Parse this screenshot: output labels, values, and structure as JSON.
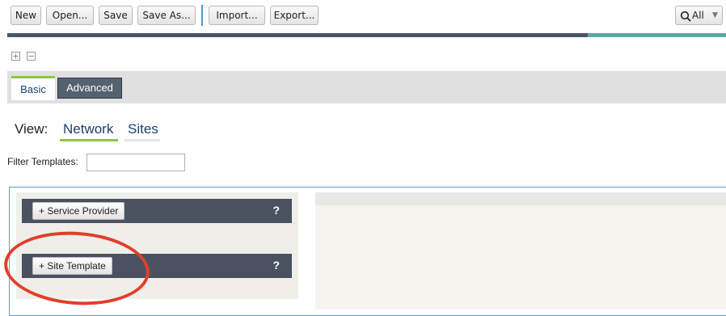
{
  "toolbar": {
    "new": "New",
    "open": "Open...",
    "save": "Save",
    "save_as": "Save As...",
    "import": "Import...",
    "export": "Export...",
    "search_scope": "All"
  },
  "colors": {
    "progress_dark": "#4a5769",
    "progress_teal": "#5aa9a9",
    "accent_green": "#8cc63f",
    "annotation_red": "#e0402a"
  },
  "tabs": {
    "basic": "Basic",
    "advanced": "Advanced"
  },
  "view": {
    "label": "View:",
    "network": "Network",
    "sites": "Sites"
  },
  "filter": {
    "label": "Filter Templates:",
    "value": ""
  },
  "templates": [
    {
      "label": "+ Service Provider",
      "help": "?"
    },
    {
      "label": "+ Site Template",
      "help": "?"
    }
  ]
}
